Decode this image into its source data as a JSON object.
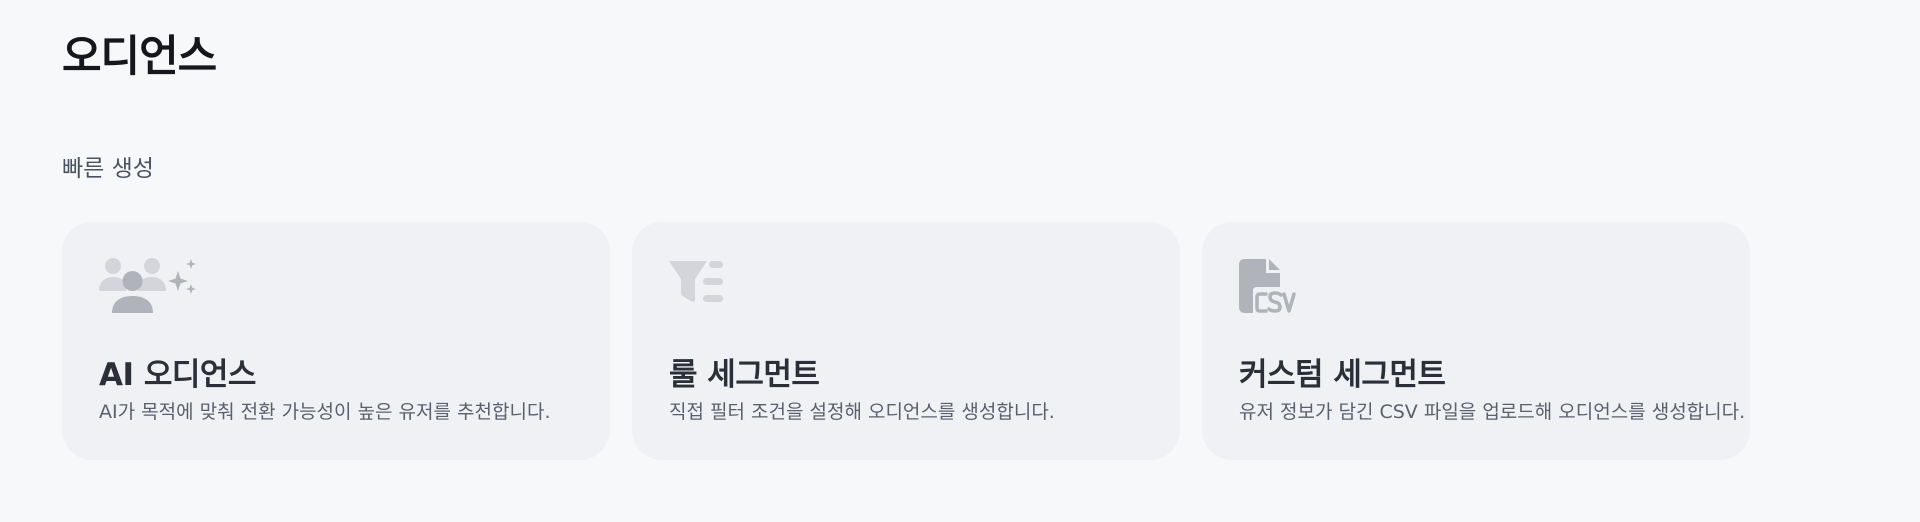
{
  "page": {
    "title": "오디언스"
  },
  "quick_create": {
    "section_title": "빠른 생성",
    "cards": [
      {
        "icon": "ai-audience-icon",
        "title": "AI 오디언스",
        "description": "AI가 목적에 맞춰 전환 가능성이 높은 유저를 추천합니다."
      },
      {
        "icon": "filter-list-icon",
        "title": "룰 세그먼트",
        "description": "직접 필터 조건을 설정해 오디언스를 생성합니다."
      },
      {
        "icon": "csv-file-icon",
        "title": "커스텀 세그먼트",
        "description": "유저 정보가 담긴 CSV 파일을 업로드해 오디언스를 생성합니다."
      }
    ]
  },
  "colors": {
    "background": "#f7f8fa",
    "card_background": "#f0f1f4",
    "icon_gray": "#b0b3ba",
    "icon_light_gray": "#d3d5da"
  }
}
